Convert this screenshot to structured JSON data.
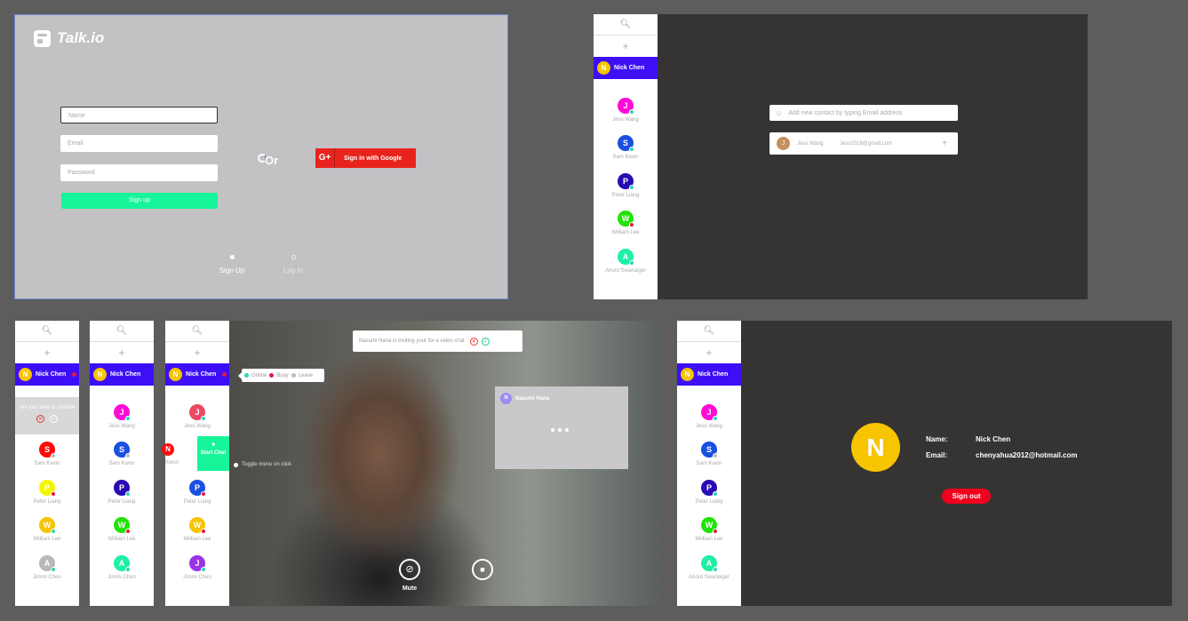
{
  "colors": {
    "accent_blue": "#3d0ff6",
    "primary_green": "#17f59a",
    "google_red": "#e8231d",
    "signout_red": "#f0001d",
    "online": "#2fd7b5",
    "busy": "#e8183b",
    "leave": "#bbbbbb"
  },
  "signup": {
    "logo": "Talk.io",
    "name_placeholder": "Name",
    "email_placeholder": "Email",
    "password_placeholder": "Password",
    "signup_button": "Sign up",
    "or": "Or",
    "google_icon": "G+",
    "google_button": "Sign in with Google",
    "tab_signup": "Sign Up",
    "tab_login": "Log In"
  },
  "me": {
    "initial": "N",
    "name": "Nick Chen",
    "email": "chenyahua2012@hotmail.com"
  },
  "sidebar": {
    "search_icon": "search-icon",
    "add_icon": "plus-icon"
  },
  "contacts": [
    {
      "initial": "J",
      "name": "Jess Wang",
      "color": "#ff0bd6",
      "status": "online"
    },
    {
      "initial": "S",
      "name": "Sam Kwon",
      "color": "#1a4fe0",
      "status": "online"
    },
    {
      "initial": "P",
      "name": "Peter Liang",
      "color": "#2a0ab4",
      "status": "online"
    },
    {
      "initial": "W",
      "name": "William Lee",
      "color": "#22e20a",
      "status": "busy"
    },
    {
      "initial": "A",
      "name": "Anord Swanaiger",
      "color": "#1ff0a4",
      "status": "online"
    }
  ],
  "contacts_panel1": [
    {
      "initial": "S",
      "name": "Sam Kwon",
      "color": "#ff0b0b"
    },
    {
      "initial": "P",
      "name": "Peter Liang",
      "color": "#f4f400"
    },
    {
      "initial": "W",
      "name": "William Lee",
      "color": "#f7c400"
    },
    {
      "initial": "A",
      "name": "Jimmi Chen",
      "color": "#b8b8b8"
    }
  ],
  "contacts_panel2": [
    {
      "initial": "J",
      "name": "Jess Wang",
      "color": "#ff0bd6"
    },
    {
      "initial": "S",
      "name": "Sam Kwon",
      "color": "#1a4fe0"
    },
    {
      "initial": "P",
      "name": "Peter Liang",
      "color": "#2a0ab4"
    },
    {
      "initial": "W",
      "name": "William Lee",
      "color": "#22e20a"
    },
    {
      "initial": "A",
      "name": "Jimmi Chen",
      "color": "#1ff0a4"
    }
  ],
  "contacts_panel3": [
    {
      "initial": "J",
      "name": "Jess Wang",
      "color": "#ec4a63"
    },
    {
      "initial": "P",
      "name": "Peter Liang",
      "color": "#1a4fe0"
    },
    {
      "initial": "W",
      "name": "William Lee",
      "color": "#f7c400"
    },
    {
      "initial": "J",
      "name": "Jimmi Chen",
      "color": "#9a34e8"
    }
  ],
  "add_contact": {
    "placeholder": "Add new contact by typing Email address",
    "suggestion_initial": "J",
    "suggestion_name": "Jess Wang",
    "suggestion_email": "Jess2018@gmail.com",
    "add": "+"
  },
  "remove_confirm": {
    "question": "Are you sure to remove",
    "cancel": "✕",
    "ok": "✓"
  },
  "peek_contact": {
    "initial": "N",
    "name": "Kwon"
  },
  "start_chat": {
    "icon": "■",
    "label": "Start Chat"
  },
  "status_menu": {
    "online": "Online",
    "busy": "Busy",
    "leave": "Leave"
  },
  "toggle_hint": "Toggle menu on click",
  "video": {
    "invite_text": "Nasumi Hana is inviting your for a video chat",
    "caller_initial": "N",
    "caller_name": "Nasumi Hana",
    "mute_label": "Mute",
    "mute_icon": "⊘",
    "stop_icon": "■"
  },
  "profile": {
    "name_label": "Name:",
    "email_label": "Email:",
    "signout": "Sign out"
  }
}
